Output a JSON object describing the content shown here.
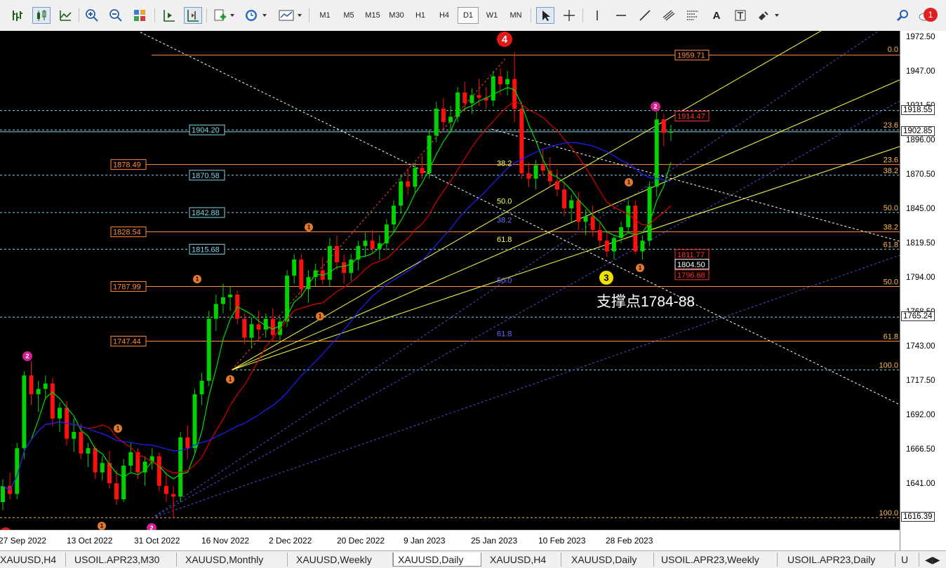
{
  "toolbar": {
    "timeframes": [
      "M1",
      "M5",
      "M15",
      "M30",
      "H1",
      "H4",
      "D1",
      "W1",
      "MN"
    ],
    "active_timeframe": "D1",
    "notification_count": "1",
    "icons": [
      "bar-chart-icon",
      "candlestick-icon",
      "line-chart-icon",
      "zoom-in-icon",
      "zoom-out-icon",
      "tile-windows-icon",
      "autoscroll-icon",
      "chart-shift-icon",
      "new-order-icon",
      "history-icon",
      "templates-icon",
      "cursor-icon",
      "crosshair-icon",
      "vertical-line-icon",
      "horizontal-line-icon",
      "trendline-icon",
      "equidistant-channel-icon",
      "fibonacci-icon",
      "text-icon",
      "text-label-icon",
      "shapes-icon",
      "search-icon"
    ]
  },
  "chart": {
    "annotation": "支撑点1784-88",
    "wave_labels": {
      "w4": "4",
      "w3": "3",
      "w2": "2",
      "w1": "1"
    },
    "left_price_labels": [
      {
        "price": 1904.2,
        "text": "1904.20",
        "kind": "cyan"
      },
      {
        "price": 1878.49,
        "text": "1878.49",
        "kind": "orange"
      },
      {
        "price": 1870.58,
        "text": "1870.58",
        "kind": "cyan"
      },
      {
        "price": 1842.88,
        "text": "1842.88",
        "kind": "cyan"
      },
      {
        "price": 1828.54,
        "text": "1828.54",
        "kind": "orange"
      },
      {
        "price": 1815.68,
        "text": "1815.68",
        "kind": "cyan"
      },
      {
        "price": 1787.99,
        "text": "1787.99",
        "kind": "orange"
      },
      {
        "price": 1747.44,
        "text": "1747.44",
        "kind": "orange"
      }
    ],
    "right_fib_labels": [
      {
        "price": 1960.5,
        "text": "0.0"
      },
      {
        "price": 1904.4,
        "text": "23.6"
      },
      {
        "price": 1878.49,
        "text": "23.6"
      },
      {
        "price": 1870.58,
        "text": "38.2"
      },
      {
        "price": 1842.88,
        "text": "50.0"
      },
      {
        "price": 1828.54,
        "text": "38.2"
      },
      {
        "price": 1815.68,
        "text": "61.8"
      },
      {
        "price": 1787.99,
        "text": "50.0"
      },
      {
        "price": 1747.44,
        "text": "61.8"
      },
      {
        "price": 1726.0,
        "text": "100.0"
      },
      {
        "price": 1616.5,
        "text": "100.0"
      }
    ],
    "inner_fib_labels": [
      {
        "price": 1877.5,
        "text": "38.2",
        "color": "#ffff66"
      },
      {
        "price": 1849.5,
        "text": "50.0",
        "color": "#ffff66"
      },
      {
        "price": 1835.5,
        "text": "38.2",
        "color": "#6a6aff"
      },
      {
        "price": 1821.0,
        "text": "61.8",
        "color": "#ffff66"
      },
      {
        "price": 1790.5,
        "text": "50.0",
        "color": "#6a6aff"
      },
      {
        "price": 1751.0,
        "text": "61.8",
        "color": "#6a6aff"
      }
    ],
    "price_boxes": [
      {
        "price": 1959.71,
        "text": "1959.71",
        "style": "orange"
      },
      {
        "price": 1914.47,
        "text": "1914.47",
        "style": "red"
      },
      {
        "price": 1811.77,
        "text": "1811.77",
        "style": "red"
      },
      {
        "price": 1804.5,
        "text": "1804.50",
        "style": "white"
      },
      {
        "price": 1796.68,
        "text": "1796.68",
        "style": "red"
      }
    ]
  },
  "price_axis": {
    "ticks": [
      "1972.50",
      "1947.00",
      "1921.50",
      "1896.00",
      "1870.50",
      "1845.00",
      "1819.50",
      "1794.00",
      "1768.50",
      "1743.00",
      "1717.50",
      "1692.00",
      "1666.50",
      "1641.00"
    ],
    "markers": [
      {
        "text": "1918.55",
        "price": 1918.55,
        "style": "white"
      },
      {
        "text": "1902.85",
        "price": 1902.85,
        "style": "white"
      },
      {
        "text": "1765.24",
        "price": 1765.24,
        "style": "white"
      },
      {
        "text": "1616.39",
        "price": 1616.39,
        "style": "white"
      }
    ]
  },
  "time_axis": {
    "labels": [
      "27 Sep 2022",
      "13 Oct 2022",
      "31 Oct 2022",
      "16 Nov 2022",
      "2 Dec 2022",
      "20 Dec 2022",
      "9 Jan 2023",
      "25 Jan 2023",
      "10 Feb 2023",
      "28 Feb 2023"
    ]
  },
  "tabs": {
    "items": [
      "XAUUSD,H4",
      "USOIL.APR23,M30",
      "XAUUSD,Monthly",
      "XAUUSD,Weekly",
      "XAUUSD,Daily",
      "XAUUSD,H4",
      "XAUUSD,Daily",
      "USOIL.APR23,Weekly",
      "USOIL.APR23,Daily",
      "U"
    ],
    "active_index": 4
  },
  "chart_data": {
    "type": "candlestick",
    "symbol": "XAUUSD,Daily",
    "ylim": [
      1610,
      1982
    ],
    "candles": [
      [
        1628,
        1645,
        1622,
        1640
      ],
      [
        1640,
        1650,
        1630,
        1634
      ],
      [
        1634,
        1672,
        1630,
        1668
      ],
      [
        1668,
        1725,
        1660,
        1722
      ],
      [
        1722,
        1733,
        1700,
        1708
      ],
      [
        1708,
        1718,
        1695,
        1712
      ],
      [
        1712,
        1722,
        1704,
        1716
      ],
      [
        1716,
        1720,
        1684,
        1690
      ],
      [
        1690,
        1702,
        1680,
        1698
      ],
      [
        1698,
        1703,
        1670,
        1675
      ],
      [
        1675,
        1690,
        1665,
        1680
      ],
      [
        1680,
        1686,
        1660,
        1664
      ],
      [
        1664,
        1672,
        1654,
        1668
      ],
      [
        1668,
        1670,
        1645,
        1650
      ],
      [
        1650,
        1662,
        1644,
        1657
      ],
      [
        1657,
        1666,
        1638,
        1642
      ],
      [
        1642,
        1652,
        1626,
        1630
      ],
      [
        1630,
        1660,
        1628,
        1655
      ],
      [
        1655,
        1672,
        1650,
        1665
      ],
      [
        1665,
        1668,
        1645,
        1650
      ],
      [
        1650,
        1662,
        1640,
        1658
      ],
      [
        1658,
        1668,
        1652,
        1662
      ],
      [
        1662,
        1665,
        1636,
        1640
      ],
      [
        1640,
        1650,
        1628,
        1634
      ],
      [
        1634,
        1640,
        1616,
        1632
      ],
      [
        1632,
        1680,
        1628,
        1676
      ],
      [
        1676,
        1685,
        1660,
        1668
      ],
      [
        1668,
        1712,
        1665,
        1708
      ],
      [
        1708,
        1724,
        1700,
        1718
      ],
      [
        1718,
        1770,
        1714,
        1764
      ],
      [
        1764,
        1782,
        1755,
        1775
      ],
      [
        1775,
        1790,
        1768,
        1780
      ],
      [
        1780,
        1788,
        1770,
        1782
      ],
      [
        1782,
        1785,
        1760,
        1764
      ],
      [
        1764,
        1768,
        1745,
        1750
      ],
      [
        1750,
        1765,
        1742,
        1760
      ],
      [
        1760,
        1770,
        1748,
        1756
      ],
      [
        1756,
        1768,
        1750,
        1764
      ],
      [
        1764,
        1772,
        1748,
        1752
      ],
      [
        1752,
        1765,
        1748,
        1762
      ],
      [
        1762,
        1800,
        1758,
        1796
      ],
      [
        1796,
        1812,
        1790,
        1808
      ],
      [
        1808,
        1812,
        1780,
        1786
      ],
      [
        1786,
        1800,
        1776,
        1795
      ],
      [
        1795,
        1805,
        1788,
        1800
      ],
      [
        1800,
        1810,
        1790,
        1793
      ],
      [
        1793,
        1824,
        1788,
        1818
      ],
      [
        1818,
        1826,
        1800,
        1806
      ],
      [
        1806,
        1812,
        1790,
        1798
      ],
      [
        1798,
        1812,
        1792,
        1808
      ],
      [
        1808,
        1822,
        1800,
        1818
      ],
      [
        1818,
        1828,
        1810,
        1822
      ],
      [
        1822,
        1830,
        1812,
        1816
      ],
      [
        1816,
        1826,
        1808,
        1820
      ],
      [
        1820,
        1838,
        1815,
        1834
      ],
      [
        1834,
        1852,
        1828,
        1848
      ],
      [
        1848,
        1870,
        1842,
        1866
      ],
      [
        1866,
        1876,
        1856,
        1862
      ],
      [
        1862,
        1880,
        1858,
        1876
      ],
      [
        1876,
        1885,
        1868,
        1872
      ],
      [
        1872,
        1904,
        1868,
        1900
      ],
      [
        1900,
        1925,
        1895,
        1920
      ],
      [
        1920,
        1928,
        1905,
        1910
      ],
      [
        1910,
        1922,
        1902,
        1914
      ],
      [
        1914,
        1936,
        1910,
        1932
      ],
      [
        1932,
        1940,
        1918,
        1924
      ],
      [
        1924,
        1935,
        1916,
        1930
      ],
      [
        1930,
        1942,
        1922,
        1928
      ],
      [
        1928,
        1936,
        1920,
        1926
      ],
      [
        1926,
        1948,
        1922,
        1944
      ],
      [
        1944,
        1950,
        1930,
        1938
      ],
      [
        1938,
        1948,
        1930,
        1942
      ],
      [
        1942,
        1962,
        1910,
        1920
      ],
      [
        1920,
        1925,
        1868,
        1872
      ],
      [
        1872,
        1880,
        1862,
        1868
      ],
      [
        1868,
        1882,
        1860,
        1878
      ],
      [
        1878,
        1890,
        1870,
        1874
      ],
      [
        1874,
        1884,
        1862,
        1866
      ],
      [
        1866,
        1875,
        1855,
        1860
      ],
      [
        1860,
        1866,
        1840,
        1846
      ],
      [
        1846,
        1856,
        1836,
        1852
      ],
      [
        1852,
        1858,
        1830,
        1836
      ],
      [
        1836,
        1845,
        1826,
        1840
      ],
      [
        1840,
        1848,
        1825,
        1830
      ],
      [
        1830,
        1836,
        1818,
        1822
      ],
      [
        1822,
        1828,
        1810,
        1814
      ],
      [
        1814,
        1826,
        1808,
        1824
      ],
      [
        1824,
        1836,
        1820,
        1832
      ],
      [
        1832,
        1852,
        1828,
        1848
      ],
      [
        1848,
        1852,
        1812,
        1814
      ],
      [
        1814,
        1826,
        1808,
        1822
      ],
      [
        1822,
        1866,
        1818,
        1862
      ],
      [
        1862,
        1918,
        1855,
        1912
      ],
      [
        1912,
        1916,
        1892,
        1902
      ],
      [
        1902,
        1908,
        1896,
        1903
      ]
    ],
    "moving_averages": [
      {
        "name": "fast",
        "color": "#00dd00"
      },
      {
        "name": "mid",
        "color": "#dd0000"
      },
      {
        "name": "slow",
        "color": "#2020ff"
      }
    ]
  }
}
